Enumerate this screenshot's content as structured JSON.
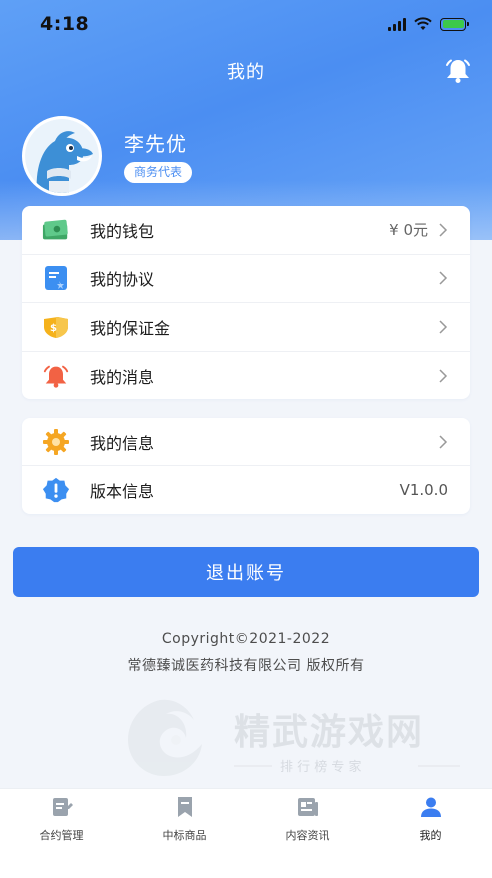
{
  "status_bar": {
    "time": "4:18"
  },
  "header": {
    "title": "我的"
  },
  "profile": {
    "name": "李先优",
    "role": "商务代表"
  },
  "menu_main": [
    {
      "label": "我的钱包",
      "value": "¥ 0元",
      "icon": "wallet-icon"
    },
    {
      "label": "我的协议",
      "value": "",
      "icon": "agreement-icon"
    },
    {
      "label": "我的保证金",
      "value": "",
      "icon": "deposit-shield-icon"
    },
    {
      "label": "我的消息",
      "value": "",
      "icon": "message-bell-icon"
    }
  ],
  "menu_info": [
    {
      "label": "我的信息",
      "value": "",
      "icon": "info-gear-icon"
    },
    {
      "label": "版本信息",
      "value": "V1.0.0",
      "icon": "version-badge-icon"
    }
  ],
  "logout_label": "退出账号",
  "copyright": {
    "line1": "Copyright©2021-2022",
    "line2": "常德臻诚医药科技有限公司  版权所有"
  },
  "watermark": {
    "title": "精武游戏网",
    "subtitle": "排 行 榜 专 家"
  },
  "tabbar": [
    {
      "label": "合约管理",
      "icon": "contract-icon",
      "active": false
    },
    {
      "label": "中标商品",
      "icon": "bookmark-icon",
      "active": false
    },
    {
      "label": "内容资讯",
      "icon": "news-icon",
      "active": false
    },
    {
      "label": "我的",
      "icon": "user-icon",
      "active": true
    }
  ],
  "colors": {
    "primary": "#3b7df0",
    "header": "#4b8ef2",
    "background": "#f2f5fa"
  }
}
